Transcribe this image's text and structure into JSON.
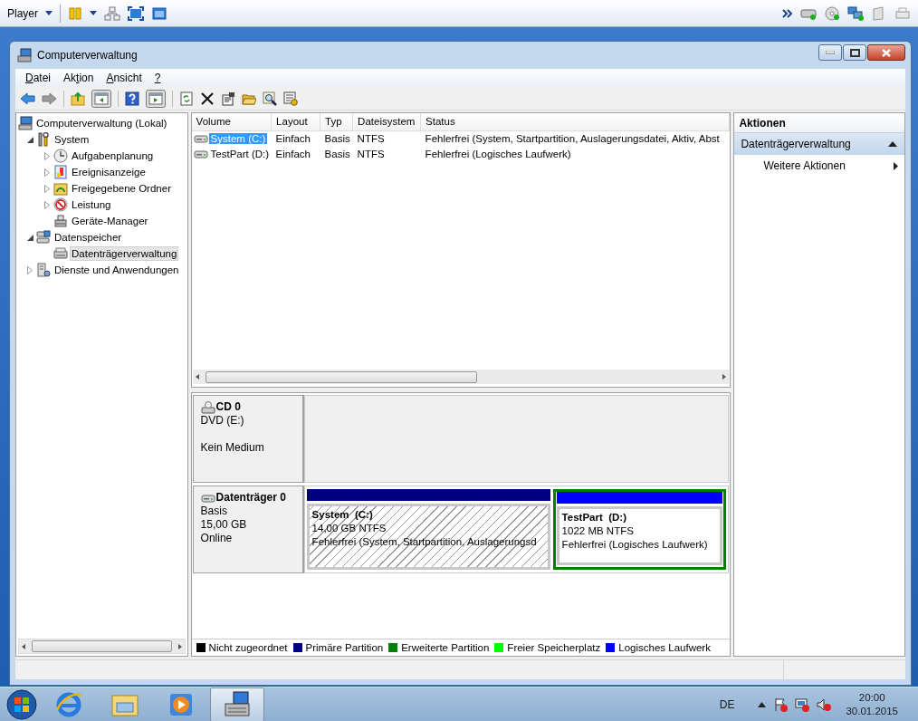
{
  "player_bar": {
    "label": "Player"
  },
  "window": {
    "title": "Computerverwaltung"
  },
  "menu": [
    {
      "key": "D",
      "post": "atei"
    },
    {
      "pre": "Ak",
      "key": "t",
      "post": "ion"
    },
    {
      "key": "A",
      "post": "nsicht"
    },
    {
      "key": "?"
    }
  ],
  "tree": [
    {
      "label": "Computerverwaltung (Lokal)",
      "kind": "computer",
      "selected": false,
      "children": [
        {
          "label": "System",
          "kind": "tools",
          "selected": false,
          "expanded": true,
          "children": [
            {
              "label": "Aufgabenplanung",
              "kind": "clock",
              "selected": false,
              "expanded": false
            },
            {
              "label": "Ereignisanzeige",
              "kind": "events",
              "selected": false,
              "expanded": false
            },
            {
              "label": "Freigegebene Ordner",
              "kind": "share",
              "selected": false,
              "expanded": false
            },
            {
              "label": "Leistung",
              "kind": "performance",
              "selected": false,
              "expanded": false
            },
            {
              "label": "Geräte-Manager",
              "kind": "devices",
              "selected": false
            }
          ]
        },
        {
          "label": "Datenspeicher",
          "kind": "storage",
          "selected": false,
          "expanded": true,
          "children": [
            {
              "label": "Datenträgerverwaltung",
              "kind": "disk",
              "selected": true
            }
          ]
        },
        {
          "label": "Dienste und Anwendungen",
          "kind": "services",
          "selected": false,
          "expanded": false
        }
      ]
    }
  ],
  "volumes": {
    "columns": [
      "Volume",
      "Layout",
      "Typ",
      "Dateisystem",
      "Status"
    ],
    "rows": [
      {
        "cells": [
          "System (C:)",
          "Einfach",
          "Basis",
          "NTFS",
          "Fehlerfrei (System, Startpartition, Auslagerungsdatei, Aktiv, Abst"
        ],
        "selected": true
      },
      {
        "cells": [
          "TestPart (D:)",
          "Einfach",
          "Basis",
          "NTFS",
          "Fehlerfrei (Logisches Laufwerk)"
        ],
        "selected": false
      }
    ]
  },
  "disks": [
    {
      "kind": "cd",
      "name": "CD 0",
      "type": "DVD (E:)",
      "status": "Kein Medium"
    },
    {
      "kind": "disk",
      "name": "Datenträger 0",
      "type": "Basis",
      "size": "15,00 GB",
      "status": "Online",
      "partitions": [
        {
          "name": "System  (C:)",
          "size": "14,00 GB NTFS",
          "status": "Fehlerfrei (System, Startpartition, Auslagerungsd",
          "color": "#000080",
          "selected": true,
          "extended": false
        },
        {
          "name": "TestPart  (D:)",
          "size": "1022 MB NTFS",
          "status": "Fehlerfrei (Logisches Laufwerk)",
          "color": "#0000ff",
          "selected": false,
          "extended": true
        }
      ]
    }
  ],
  "legend": [
    {
      "label": "Nicht zugeordnet",
      "color": "#000000"
    },
    {
      "label": "Primäre Partition",
      "color": "#000080"
    },
    {
      "label": "Erweiterte Partition",
      "color": "#008000"
    },
    {
      "label": "Freier Speicherplatz",
      "color": "#00ff00"
    },
    {
      "label": "Logisches Laufwerk",
      "color": "#0000ff"
    }
  ],
  "actions": {
    "title": "Aktionen",
    "section": {
      "label": "Datenträgerverwaltung",
      "expanded": true
    },
    "items": [
      "Weitere Aktionen"
    ]
  },
  "taskbar": {
    "apps": [
      {
        "kind": "browser",
        "selected": false
      },
      {
        "kind": "folder",
        "selected": false
      },
      {
        "kind": "media",
        "selected": false
      },
      {
        "kind": "management",
        "selected": true
      }
    ],
    "language": "DE",
    "time": "20:00",
    "date": "30.01.2015"
  }
}
